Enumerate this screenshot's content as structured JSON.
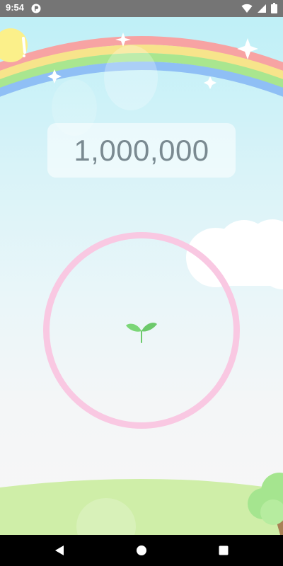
{
  "status_bar": {
    "time": "9:54",
    "icons": [
      "app-notification-icon",
      "wifi-icon",
      "cellular-signal-icon",
      "battery-icon"
    ]
  },
  "game": {
    "counter": "1,000,000",
    "ring_color": "#f9c8e2",
    "sprout_color": "#6cc96b"
  },
  "nav_bar": {
    "buttons": [
      "back-icon",
      "home-icon",
      "recents-icon"
    ]
  }
}
